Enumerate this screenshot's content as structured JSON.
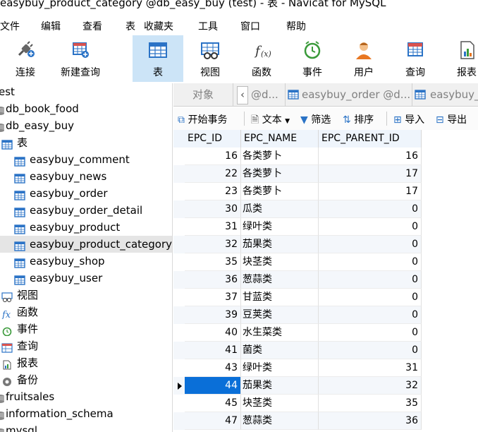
{
  "window": {
    "title": "easybuy_product_category @db_easy_buy (test) - 表 - Navicat for MySQL"
  },
  "menu": [
    "文件",
    "编辑",
    "查看",
    "表",
    "收藏夹",
    "工具",
    "窗口",
    "帮助"
  ],
  "toolbar": {
    "connect": "连接",
    "new_query": "新建查询",
    "table": "表",
    "view": "视图",
    "function": "函数",
    "event": "事件",
    "user": "用户",
    "query": "查询",
    "report": "报表"
  },
  "tree": {
    "items": [
      {
        "label": "est",
        "icon": "none",
        "indent": 0
      },
      {
        "label": "db_book_food",
        "icon": "db",
        "indent": 0
      },
      {
        "label": "db_easy_buy",
        "icon": "db",
        "indent": 0
      },
      {
        "label": "表",
        "icon": "table",
        "indent": 1
      },
      {
        "label": "easybuy_comment",
        "icon": "table",
        "indent": 2
      },
      {
        "label": "easybuy_news",
        "icon": "table",
        "indent": 2
      },
      {
        "label": "easybuy_order",
        "icon": "table",
        "indent": 2
      },
      {
        "label": "easybuy_order_detail",
        "icon": "table",
        "indent": 2
      },
      {
        "label": "easybuy_product",
        "icon": "table",
        "indent": 2
      },
      {
        "label": "easybuy_product_category",
        "icon": "table",
        "indent": 2,
        "selected": true
      },
      {
        "label": "easybuy_shop",
        "icon": "table",
        "indent": 2
      },
      {
        "label": "easybuy_user",
        "icon": "table",
        "indent": 2
      },
      {
        "label": "视图",
        "icon": "view",
        "indent": 1
      },
      {
        "label": "函数",
        "icon": "function",
        "indent": 1
      },
      {
        "label": "事件",
        "icon": "event",
        "indent": 1
      },
      {
        "label": "查询",
        "icon": "query",
        "indent": 1
      },
      {
        "label": "报表",
        "icon": "report",
        "indent": 1
      },
      {
        "label": "备份",
        "icon": "backup",
        "indent": 1
      },
      {
        "label": "fruitsales",
        "icon": "db",
        "indent": 0
      },
      {
        "label": "information_schema",
        "icon": "db",
        "indent": 0
      },
      {
        "label": "mysql",
        "icon": "db",
        "indent": 0
      }
    ]
  },
  "tabs": {
    "object": "对象",
    "tab1": "@d...",
    "tab2": "easybuy_order @d...",
    "tab3": "easybuy_"
  },
  "subtoolbar": {
    "begin_tx": "开始事务",
    "text": "文本",
    "filter": "筛选",
    "sort": "排序",
    "import": "导入",
    "export": "导出"
  },
  "grid": {
    "columns": [
      "EPC_ID",
      "EPC_NAME",
      "EPC_PARENT_ID"
    ],
    "rows": [
      [
        "16",
        "各类萝卜",
        "16"
      ],
      [
        "22",
        "各类萝卜",
        "17"
      ],
      [
        "23",
        "各类萝卜",
        "17"
      ],
      [
        "30",
        "瓜类",
        "0"
      ],
      [
        "31",
        "绿叶类",
        "0"
      ],
      [
        "32",
        "茄果类",
        "0"
      ],
      [
        "35",
        "块茎类",
        "0"
      ],
      [
        "36",
        "葱蒜类",
        "0"
      ],
      [
        "37",
        "甘蓝类",
        "0"
      ],
      [
        "39",
        "豆荚类",
        "0"
      ],
      [
        "40",
        "水生菜类",
        "0"
      ],
      [
        "41",
        "菌类",
        "0"
      ],
      [
        "43",
        "绿叶类",
        "31"
      ],
      [
        "44",
        "茄果类",
        "32"
      ],
      [
        "45",
        "块茎类",
        "35"
      ],
      [
        "47",
        "葱蒜类",
        "36"
      ]
    ],
    "selected_row": 13
  },
  "colors": {
    "accent": "#0a6fd8",
    "toolbar_active": "#cce4f7",
    "table_icon": "#2b73c6"
  }
}
